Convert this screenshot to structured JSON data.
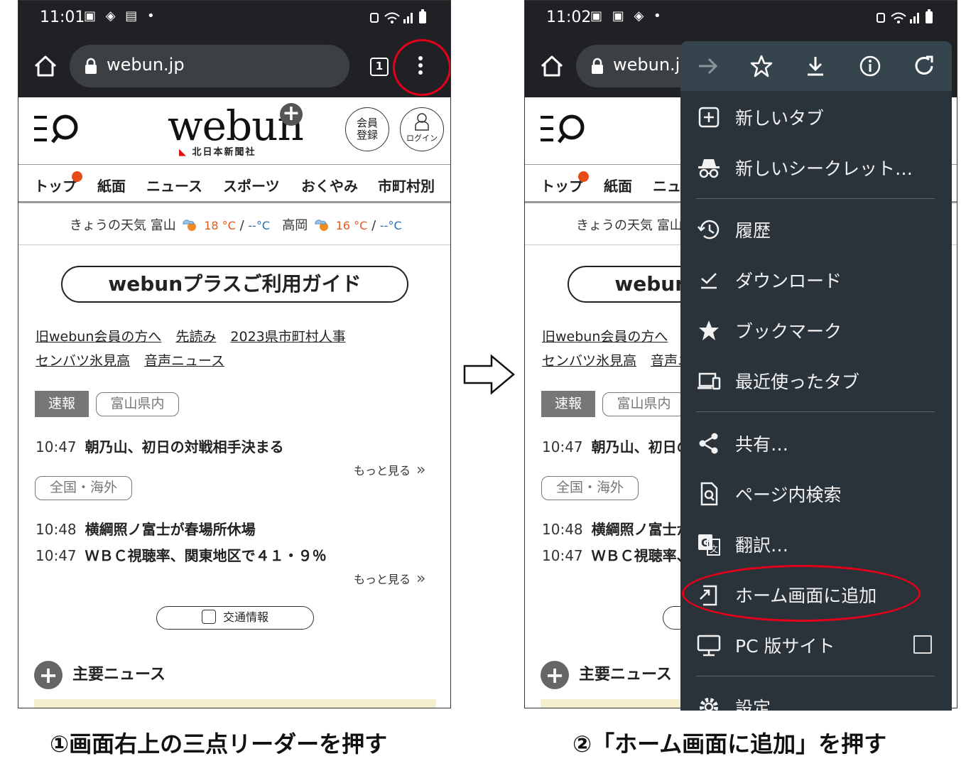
{
  "phone1": {
    "status": {
      "time": "11:01",
      "icons": "▣ ◈ ▤ •"
    },
    "url": "webun.jp",
    "tab_count": "1"
  },
  "phone2": {
    "status": {
      "time": "11:02",
      "icons": "▣ ▣ ◈ •"
    },
    "url": "webun.jp"
  },
  "site": {
    "logo": "webun",
    "logo_plus": "+",
    "logo_sub": "北日本新聞社",
    "register": [
      "会員",
      "登録"
    ],
    "login": "ログイン",
    "nav": [
      "トップ",
      "紙面",
      "ニュース",
      "スポーツ",
      "おくやみ",
      "市町村別"
    ],
    "weather": {
      "label": "きょうの天気",
      "city1": "富山",
      "hi1": "18 °C",
      "lo1": "--°C",
      "city2": "高岡",
      "hi2": "16 °C",
      "lo2": "--°C",
      "sep": "/"
    },
    "guide": "webunプラスご利用ガイド",
    "links_row1": [
      "旧webun会員の方へ",
      "先読み",
      "2023県市町村人事"
    ],
    "links_row2": [
      "センバツ氷見高",
      "音声ニュース"
    ],
    "tab_breaking": "速報",
    "tab_toyama": "富山県内",
    "news1": {
      "time": "10:47",
      "headline": "朝乃山、初日の対戦相手決まる"
    },
    "more": "もっと見る",
    "more_chev": "»",
    "tab_national": "全国・海外",
    "news2": {
      "time": "10:48",
      "headline": "横綱照ノ富士が春場所休場"
    },
    "news3": {
      "time": "10:47",
      "headline": "ＷＢＣ視聴率、関東地区で４１・９％"
    },
    "traffic": "交通情報",
    "main_news": "主要ニュース"
  },
  "menu": {
    "items": [
      {
        "label": "新しいタブ",
        "icon": "new-tab-icon"
      },
      {
        "label": "新しいシークレット…",
        "icon": "incognito-icon"
      },
      {
        "label": "履歴",
        "icon": "history-icon"
      },
      {
        "label": "ダウンロード",
        "icon": "download-done-icon"
      },
      {
        "label": "ブックマーク",
        "icon": "bookmark-star-icon"
      },
      {
        "label": "最近使ったタブ",
        "icon": "recent-tabs-icon"
      },
      {
        "label": "共有…",
        "icon": "share-icon"
      },
      {
        "label": "ページ内検索",
        "icon": "find-in-page-icon"
      },
      {
        "label": "翻訳…",
        "icon": "translate-icon"
      },
      {
        "label": "ホーム画面に追加",
        "icon": "add-to-home-icon"
      },
      {
        "label": "PC 版サイト",
        "icon": "desktop-icon"
      },
      {
        "label": "設定",
        "icon": "settings-icon"
      }
    ],
    "desktop_site_checked": false
  },
  "captions": {
    "step1": "①画面右上の三点リーダーを押す",
    "step2": "②「ホーム画面に追加」を押す"
  },
  "colors": {
    "highlight_ring": "#e3001b",
    "menu_bg": "#2a333a",
    "toolbar_bg": "#202124"
  }
}
